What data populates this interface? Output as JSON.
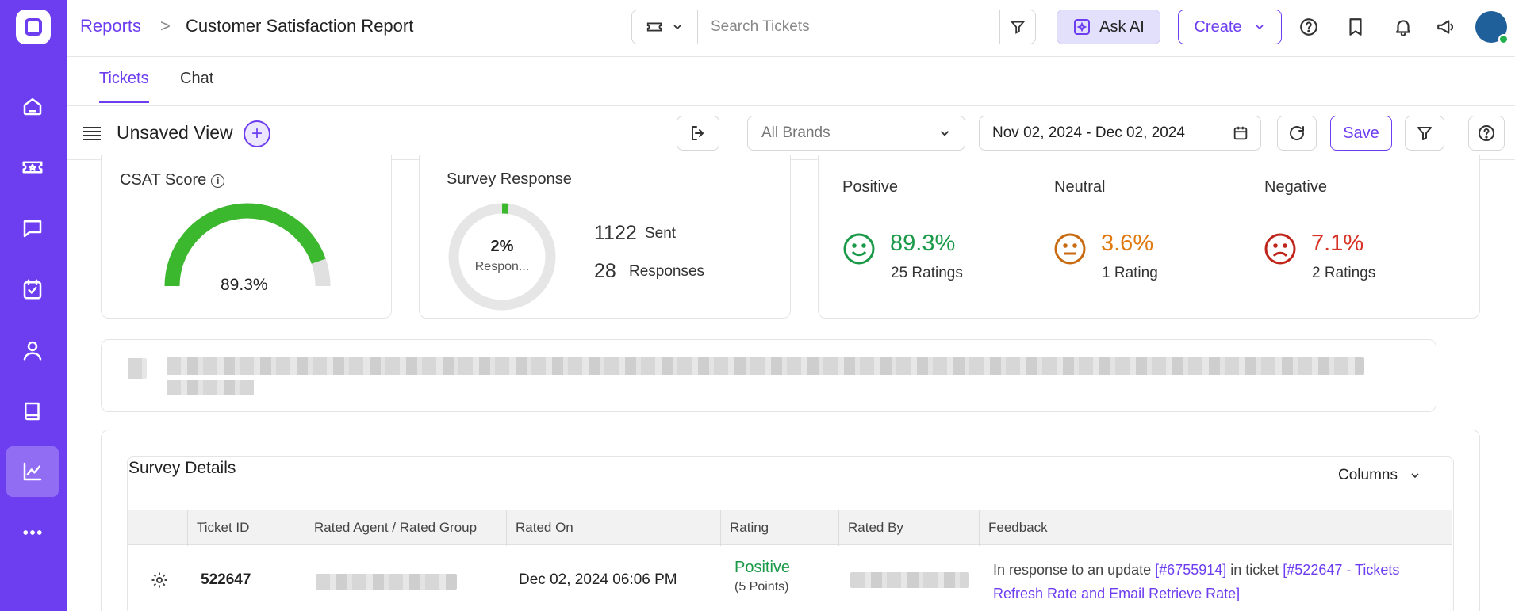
{
  "header": {
    "breadcrumb_root": "Reports",
    "breadcrumb_sep": ">",
    "title": "Customer Satisfaction Report",
    "search_placeholder": "Search Tickets",
    "ask_ai_label": "Ask AI",
    "create_label": "Create"
  },
  "tabs": [
    {
      "label": "Tickets",
      "active": true
    },
    {
      "label": "Chat",
      "active": false
    }
  ],
  "toolbar": {
    "view_title": "Unsaved View",
    "brand_select": "All Brands",
    "date_range": "Nov 02, 2024 - Dec 02, 2024",
    "save_label": "Save"
  },
  "csat": {
    "title": "CSAT Score",
    "value": "89.3%",
    "fraction": 0.893
  },
  "survey": {
    "title": "Survey Response",
    "percent": "2%",
    "percent_sub": "Respon...",
    "fraction": 0.02,
    "sent_count": "1122",
    "sent_label": "Sent",
    "responses_count": "28",
    "responses_label": "Responses"
  },
  "sentiment": [
    {
      "label": "Positive",
      "percent": "89.3%",
      "ratings": "25 Ratings",
      "color": "#1a9948"
    },
    {
      "label": "Neutral",
      "percent": "3.6%",
      "ratings": "1 Rating",
      "color": "#e07a10"
    },
    {
      "label": "Negative",
      "percent": "7.1%",
      "ratings": "2 Ratings",
      "color": "#d93025"
    }
  ],
  "survey_details": {
    "title": "Survey Details",
    "columns_label": "Columns",
    "headers": [
      "Ticket ID",
      "Rated Agent / Rated Group",
      "Rated On",
      "Rating",
      "Rated By",
      "Feedback"
    ],
    "rows": [
      {
        "ticket_id": "522647",
        "rated_on": "Dec 02, 2024 06:06 PM",
        "rating": "Positive",
        "rating_points": "(5 Points)",
        "feedback_prefix": "In response to an update ",
        "feedback_link1": "[#6755914]",
        "feedback_mid": " in ticket ",
        "feedback_link2": "[#522647 - Tickets Refresh Rate and Email Retrieve Rate]"
      }
    ]
  },
  "colors": {
    "accent": "#6d3df0",
    "gauge": "#3cb82e",
    "track": "#e0e0e0"
  }
}
